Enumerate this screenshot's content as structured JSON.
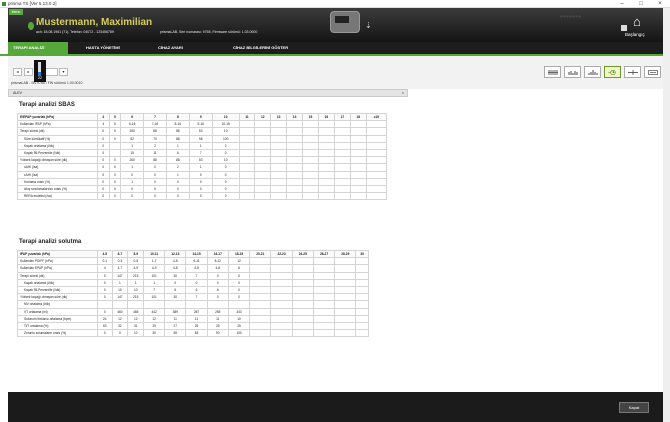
{
  "window": {
    "title": "prisma TS [Ver 5.13.0.2]",
    "buttons": [
      "–",
      "□",
      "×"
    ]
  },
  "header": {
    "menu_label": "Menu",
    "patient_name": "Mustermann, Maximilian",
    "patient_info": "ach: 18.08.1961 (71), Telefon: 04072 - 123456789",
    "device_info": "prismaLAB,  Seri numarası: 9765,  Firmware sürümü: 1.03.0000",
    "home_label": "Başlangıç",
    "colors": {
      "accent": "#57a83b",
      "name": "#d7cf5a"
    }
  },
  "tabs": [
    {
      "label": "TERAPİ ANALİZİ"
    },
    {
      "label": "HASTA YÖNETİMİ"
    },
    {
      "label": "CİHAZ AYARI"
    },
    {
      "label": "CİHAZ BİLGİLERİNİ GÖSTER"
    }
  ],
  "datebar": {
    "prev": "◂",
    "next": "▸",
    "popup_value": "22",
    "firmware": "prismaLAB - SN 9765 / FW sürümü 1.00.0010",
    "view_icons": [
      "list-view-icon",
      "bar-chart-icon",
      "histogram-icon",
      "clock-chart-icon",
      "split-view-icon",
      "device-view-icon"
    ]
  },
  "panel": {
    "title": "ALEV",
    "close": "×"
  },
  "sbas": {
    "title": "Terapi analizi SBAS",
    "header": [
      "E/EPAP yuvarlak (hPa)",
      "4",
      "5",
      "6",
      "7",
      "8",
      "9",
      "10",
      "11",
      "12",
      "13",
      "14",
      "15",
      "16",
      "17",
      "18",
      "≥19"
    ],
    "rows": [
      {
        "label": "Kullanılan IPAP (hPa)",
        "ind": false,
        "cells": [
          "4",
          "5",
          "6-16",
          "7-16",
          "8-16",
          "9-16",
          "10-16",
          "",
          "",
          "",
          "",
          "",
          "",
          "",
          "",
          ""
        ]
      },
      {
        "label": "Terapi süresi (dk)",
        "ind": false,
        "cells": [
          "0",
          "0",
          "260",
          "88",
          "88",
          "53",
          "10",
          "",
          "",
          "",
          "",
          "",
          "",
          "",
          "",
          ""
        ]
      },
      {
        "label": "Süre kümülatif (%)",
        "ind": true,
        "cells": [
          "0",
          "0",
          "52",
          "70",
          "88",
          "98",
          "100",
          "",
          "",
          "",
          "",
          "",
          "",
          "",
          "",
          ""
        ]
      },
      {
        "label": "Kaçak ortalama (l/dk)",
        "ind": true,
        "cells": [
          "0",
          "",
          "1",
          "2",
          "1",
          "1",
          "0",
          "",
          "",
          "",
          "",
          "",
          "",
          "",
          "",
          ""
        ]
      },
      {
        "label": "Kaçak 95.Perzentile (l/dk)",
        "ind": true,
        "cells": [
          "0",
          "",
          "15",
          "11",
          "6",
          "7",
          "0",
          "",
          "",
          "",
          "",
          "",
          "",
          "",
          "",
          ""
        ]
      },
      {
        "label": "Yüksek kaçağı olmayan süre (dk)",
        "ind": false,
        "cells": [
          "0",
          "0",
          "260",
          "88",
          "88",
          "53",
          "10",
          "",
          "",
          "",
          "",
          "",
          "",
          "",
          "",
          ""
        ]
      },
      {
        "label": "oAHI (/sa)",
        "ind": true,
        "cells": [
          "0",
          "0",
          "1",
          "0",
          "2",
          "1",
          "0",
          "",
          "",
          "",
          "",
          "",
          "",
          "",
          "",
          ""
        ]
      },
      {
        "label": "cAHI (/sa)",
        "ind": true,
        "cells": [
          "0",
          "0",
          "0",
          "0",
          "1",
          "0",
          "0",
          "",
          "",
          "",
          "",
          "",
          "",
          "",
          "",
          ""
        ]
      },
      {
        "label": "Horlama oranı (%)",
        "ind": true,
        "cells": [
          "0",
          "0",
          "1",
          "0",
          "0",
          "0",
          "0",
          "",
          "",
          "",
          "",
          "",
          "",
          "",
          "",
          ""
        ]
      },
      {
        "label": "Akış sınırlamalarının oranı (%)",
        "ind": true,
        "cells": [
          "0",
          "0",
          "0",
          "0",
          "0",
          "0",
          "0",
          "",
          "",
          "",
          "",
          "",
          "",
          "",
          "",
          ""
        ]
      },
      {
        "label": "RERA endeksi (/sa)",
        "ind": true,
        "cells": [
          "0",
          "0",
          "0",
          "0",
          "0",
          "0",
          "0",
          "",
          "",
          "",
          "",
          "",
          "",
          "",
          "",
          ""
        ]
      }
    ]
  },
  "solutma": {
    "title": "Terapi analizi solutma",
    "header": [
      "IPAP yuvarlak (hPa)",
      "4-5",
      "6-7",
      "8-9",
      "10-11",
      "12-13",
      "14-15",
      "16-17",
      "18-19",
      "20-21",
      "22-23",
      "24-25",
      "26-27",
      "28-29",
      "30"
    ],
    "rows": [
      {
        "label": "Kullanılan PDIFF (hPa)",
        "ind": false,
        "cells": [
          "0-1",
          "0-3",
          "0-5",
          "1-7",
          "4-8",
          "6-11",
          "8-12",
          "12",
          "",
          "",
          "",
          "",
          "",
          ""
        ]
      },
      {
        "label": "Kullanılan EPAP (hPa)",
        "ind": false,
        "cells": [
          "4",
          "4-7",
          "4-9",
          "4-9",
          "4-8",
          "4-8",
          "4-8",
          "6",
          "",
          "",
          "",
          "",
          "",
          ""
        ]
      },
      {
        "label": "Terapi süresi (dk)",
        "ind": false,
        "cells": [
          "0",
          "147",
          "215",
          "101",
          "30",
          "7",
          "0",
          "0",
          "",
          "",
          "",
          "",
          "",
          ""
        ]
      },
      {
        "label": "Kaçak ortalama (l/dk)",
        "ind": true,
        "cells": [
          "0",
          "1",
          "1",
          "1",
          "0",
          "0",
          "0",
          "0",
          "",
          "",
          "",
          "",
          "",
          ""
        ]
      },
      {
        "label": "Kaçak 95.Perzentile (l/dk)",
        "ind": true,
        "cells": [
          "0",
          "10",
          "10",
          "7",
          "6",
          "6",
          "6",
          "0",
          "",
          "",
          "",
          "",
          "",
          ""
        ]
      },
      {
        "label": "Yüksek kaçağı olmayan süre (dk)",
        "ind": false,
        "cells": [
          "0",
          "147",
          "215",
          "101",
          "30",
          "7",
          "0",
          "0",
          "",
          "",
          "",
          "",
          "",
          ""
        ]
      },
      {
        "label": "MV ortalama (l/dk)",
        "ind": true,
        "cells": [
          "",
          "",
          "",
          "",
          "",
          "",
          "",
          "",
          "",
          "",
          "",
          "",
          "",
          ""
        ]
      },
      {
        "label": "VT ortalama (ml)",
        "ind": true,
        "cells": [
          "0",
          "460",
          "465",
          "442",
          "389",
          "287",
          "255",
          "343",
          "",
          "",
          "",
          "",
          "",
          ""
        ]
      },
      {
        "label": "Solunum frekansı ortalama (bpm)",
        "ind": true,
        "cells": [
          "24",
          "12",
          "12",
          "12",
          "11",
          "11",
          "11",
          "10",
          "",
          "",
          "",
          "",
          "",
          ""
        ]
      },
      {
        "label": "Ti/T ortalama (%)",
        "ind": true,
        "cells": [
          "63",
          "32",
          "31",
          "29",
          "27",
          "25",
          "25",
          "25",
          "",
          "",
          "",
          "",
          "",
          ""
        ]
      },
      {
        "label": "Zorunlu solumaların oranı (%)",
        "ind": true,
        "cells": [
          "0",
          "0",
          "10",
          "30",
          "55",
          "83",
          "90",
          "100",
          "",
          "",
          "",
          "",
          "",
          ""
        ]
      }
    ]
  },
  "footer": {
    "close_label": "Kapat"
  }
}
